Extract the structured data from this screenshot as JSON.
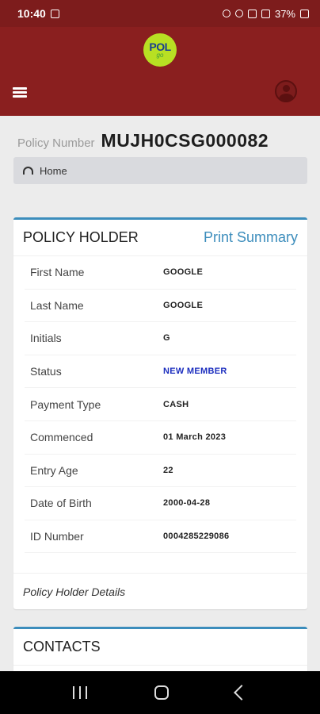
{
  "statusbar": {
    "time": "10:40",
    "battery": "37%"
  },
  "appbar": {
    "logo_text": "POL",
    "logo_sub": "go"
  },
  "policy": {
    "label": "Policy Number",
    "number": "MUJH0CSG000082"
  },
  "breadcrumb": {
    "home": "Home"
  },
  "policy_holder": {
    "title": "POLICY HOLDER",
    "print_label": "Print Summary",
    "rows": [
      {
        "label": "First Name",
        "value": "GOOGLE"
      },
      {
        "label": "Last Name",
        "value": "GOOGLE"
      },
      {
        "label": "Initials",
        "value": "G"
      },
      {
        "label": "Status",
        "value": "NEW MEMBER"
      },
      {
        "label": "Payment Type",
        "value": "CASH"
      },
      {
        "label": "Commenced",
        "value": "01 March 2023"
      },
      {
        "label": "Entry Age",
        "value": "22"
      },
      {
        "label": "Date of Birth",
        "value": "2000-04-28"
      },
      {
        "label": "ID Number",
        "value": "0004285229086"
      }
    ],
    "footer": "Policy Holder Details"
  },
  "contacts": {
    "title": "CONTACTS"
  },
  "colors": {
    "brand": "#8a1f1f",
    "accent": "#3c8dbc",
    "status": "#1d2fbf"
  }
}
